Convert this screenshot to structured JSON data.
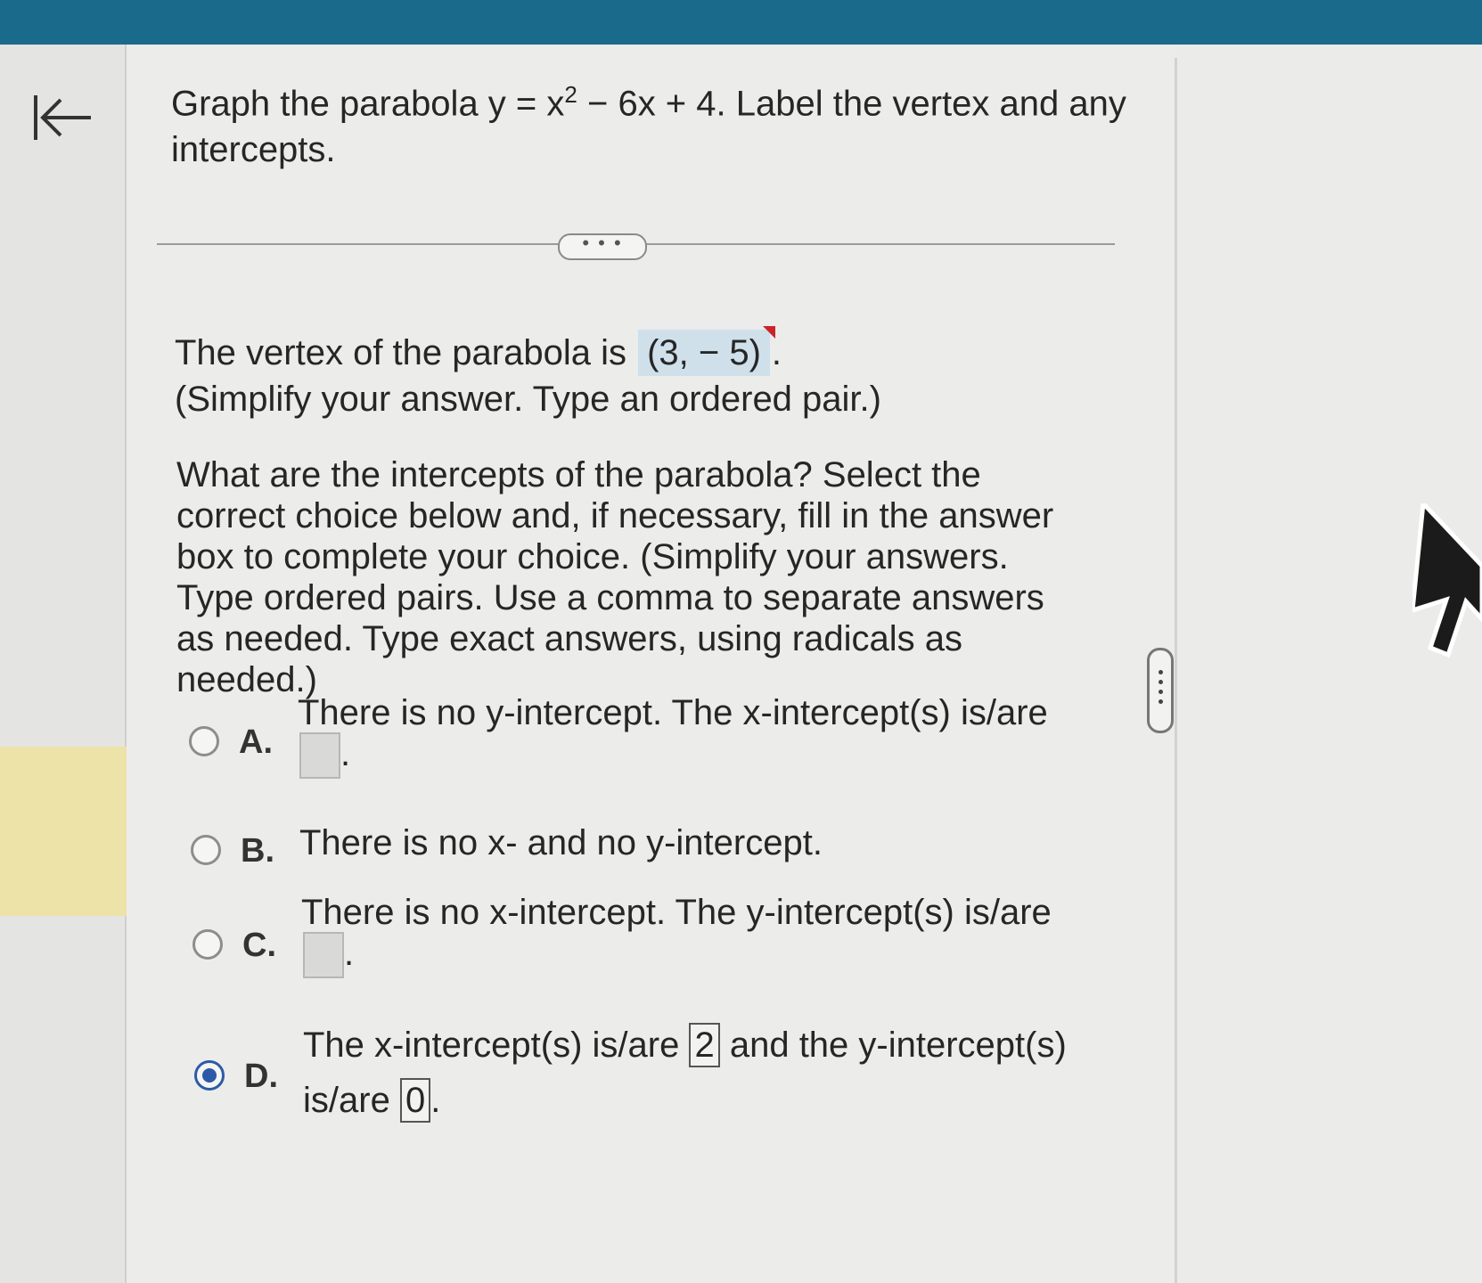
{
  "question": {
    "prefix": "Graph the parabola y = x",
    "exponent": "2",
    "suffix": " − 6x + 4. Label the vertex and any intercepts."
  },
  "more_button": "• • •",
  "vertex": {
    "prefix": "The vertex of the parabola is",
    "answer": "(3, − 5)",
    "suffix": ".",
    "hint": "(Simplify your answer. Type an ordered pair.)"
  },
  "intercepts_prompt": "What are the intercepts of the parabola? Select the correct choice below and, if necessary, fill in the answer box to complete your choice. (Simplify your answers. Type ordered pairs. Use a comma to separate answers as needed. Type exact answers, using radicals as needed.)",
  "options": {
    "a": {
      "letter": "A.",
      "text": "There is no y-intercept. The x-intercept(s) is/are",
      "after_box": "."
    },
    "b": {
      "letter": "B.",
      "text": "There is no x- and no y-intercept."
    },
    "c": {
      "letter": "C.",
      "text": "There is no x-intercept. The y-intercept(s) is/are",
      "after_box": "."
    },
    "d": {
      "letter": "D.",
      "text_1": "The x-intercept(s) is/are",
      "x_value": "2",
      "text_2": "and the y-intercept(s)",
      "text_3": "is/are",
      "y_value": "0",
      "after_box": "."
    }
  },
  "selected_option": "D",
  "colors": {
    "top_bar": "#1a6a8c",
    "selected_radio": "#2d5aa8",
    "answer_highlight": "#cfe0ea",
    "incorrect_flag": "#c8252b",
    "left_highlight": "#ede3a8"
  }
}
